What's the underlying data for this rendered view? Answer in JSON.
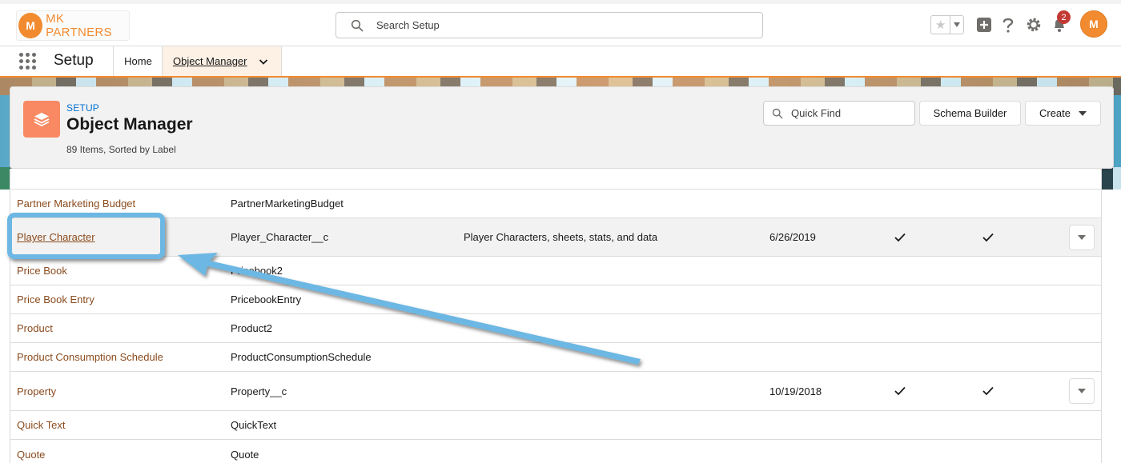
{
  "header": {
    "logo_text": "MK PARTNERS",
    "logo_mark": "M",
    "search_placeholder": "Search Setup",
    "notification_count": "2",
    "avatar_initial": "M"
  },
  "nav": {
    "app_name": "Setup",
    "items": [
      {
        "label": "Home"
      },
      {
        "label": "Object Manager"
      }
    ]
  },
  "page": {
    "eyebrow": "SETUP",
    "title": "Object Manager",
    "meta": "89 Items, Sorted by Label",
    "quick_find_placeholder": "Quick Find",
    "schema_button": "Schema Builder",
    "create_button": "Create"
  },
  "table": {
    "rows": [
      {
        "label": "Partner Marketing Budget",
        "api": "PartnerMarketingBudget",
        "desc": "",
        "date": "",
        "deployed": false,
        "custom": false
      },
      {
        "label": "Player Character",
        "api": "Player_Character__c",
        "desc": "Player Characters, sheets, stats, and data",
        "date": "6/26/2019",
        "deployed": true,
        "custom": true
      },
      {
        "label": "Price Book",
        "api": "Pricebook2",
        "desc": "",
        "date": "",
        "deployed": false,
        "custom": false
      },
      {
        "label": "Price Book Entry",
        "api": "PricebookEntry",
        "desc": "",
        "date": "",
        "deployed": false,
        "custom": false
      },
      {
        "label": "Product",
        "api": "Product2",
        "desc": "",
        "date": "",
        "deployed": false,
        "custom": false
      },
      {
        "label": "Product Consumption Schedule",
        "api": "ProductConsumptionSchedule",
        "desc": "",
        "date": "",
        "deployed": false,
        "custom": false
      },
      {
        "label": "Property",
        "api": "Property__c",
        "desc": "",
        "date": "10/19/2018",
        "deployed": true,
        "custom": true
      },
      {
        "label": "Quick Text",
        "api": "QuickText",
        "desc": "",
        "date": "",
        "deployed": false,
        "custom": false
      },
      {
        "label": "Quote",
        "api": "Quote",
        "desc": "",
        "date": "",
        "deployed": false,
        "custom": false
      }
    ]
  },
  "colors": {
    "brand_orange": "#f28b30",
    "link_brown": "#8a4b1e",
    "annotation_blue": "#6cb7e3"
  },
  "icons": [
    "search-icon",
    "star-icon",
    "plus-icon",
    "help-icon",
    "gear-icon",
    "bell-icon",
    "waffle-icon",
    "chevron-down-icon",
    "layers-icon",
    "check-icon"
  ]
}
